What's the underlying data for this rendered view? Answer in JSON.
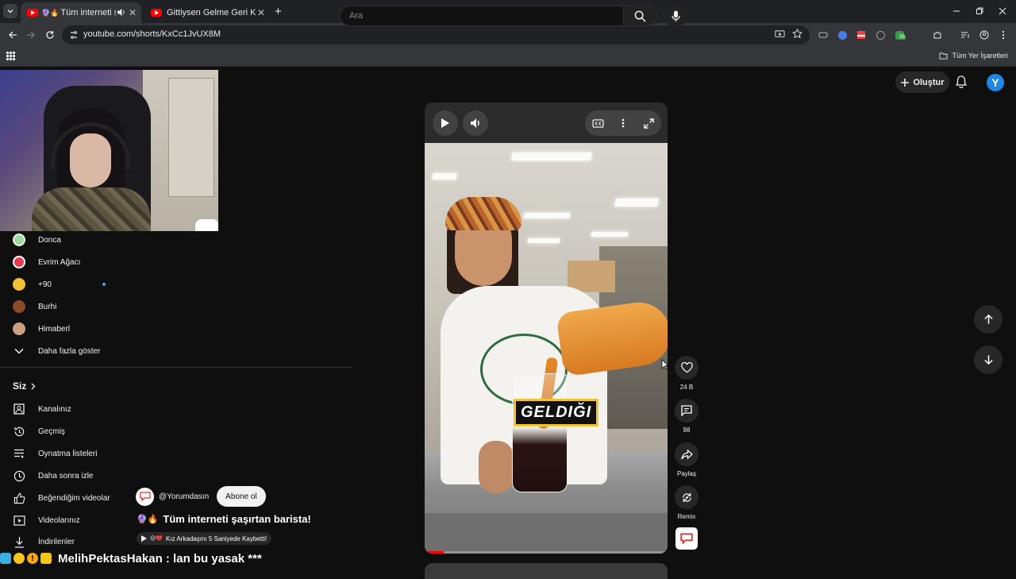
{
  "browser": {
    "tabs": [
      {
        "title": "Tüm interneti şaşırtan",
        "active": true
      },
      {
        "title": "Gittiysen Gelme Geri Kedi Versi",
        "active": false
      }
    ],
    "new_tab": "+",
    "url": "youtube.com/shorts/KxCc1JvUX8M",
    "all_bookmarks": "Tüm Yer İşaretleri",
    "extension_badge": "39"
  },
  "youtube": {
    "search_placeholder": "Ara",
    "create_label": "Oluştur",
    "avatar_letter": "Y"
  },
  "sidebar": {
    "subscriptions": [
      {
        "name": "Donca",
        "color": "#9fd8a0"
      },
      {
        "name": "Evrim Ağacı",
        "color": "#e83a4a"
      },
      {
        "name": "+90",
        "color": "#f2c037"
      },
      {
        "name": "Burhi",
        "color": "#8a4a2a"
      },
      {
        "name": "Himaberl",
        "color": "#c9a080"
      }
    ],
    "show_more": "Daha fazla göster",
    "you_header": "Siz",
    "you_items": [
      {
        "label": "Kanalınız",
        "icon": "channel-icon"
      },
      {
        "label": "Geçmiş",
        "icon": "history-icon"
      },
      {
        "label": "Oynatma listeleri",
        "icon": "playlists-icon"
      },
      {
        "label": "Daha sonra izle",
        "icon": "watch-later-icon"
      },
      {
        "label": "Beğendiğim videolar",
        "icon": "liked-videos-icon"
      },
      {
        "label": "Videolarınız",
        "icon": "your-videos-icon"
      },
      {
        "label": "İndirilenler",
        "icon": "downloads-icon"
      }
    ]
  },
  "short": {
    "caption": "GELDIĞI",
    "progress": 0.08,
    "channel": "@Yorumdasın",
    "subscribe_label": "Abone ol",
    "title": "Tüm interneti şaşırtan barista!",
    "linked_video": "Kız Arkadaşını 5 Saniyede Kaybetti!",
    "actions": {
      "like_count": "24 B",
      "comment_count": "98",
      "share_label": "Paylaş",
      "remix_label": "Remix"
    }
  },
  "stream_overlay": {
    "text": "MelihPektasHakan : lan bu yasak ***"
  }
}
